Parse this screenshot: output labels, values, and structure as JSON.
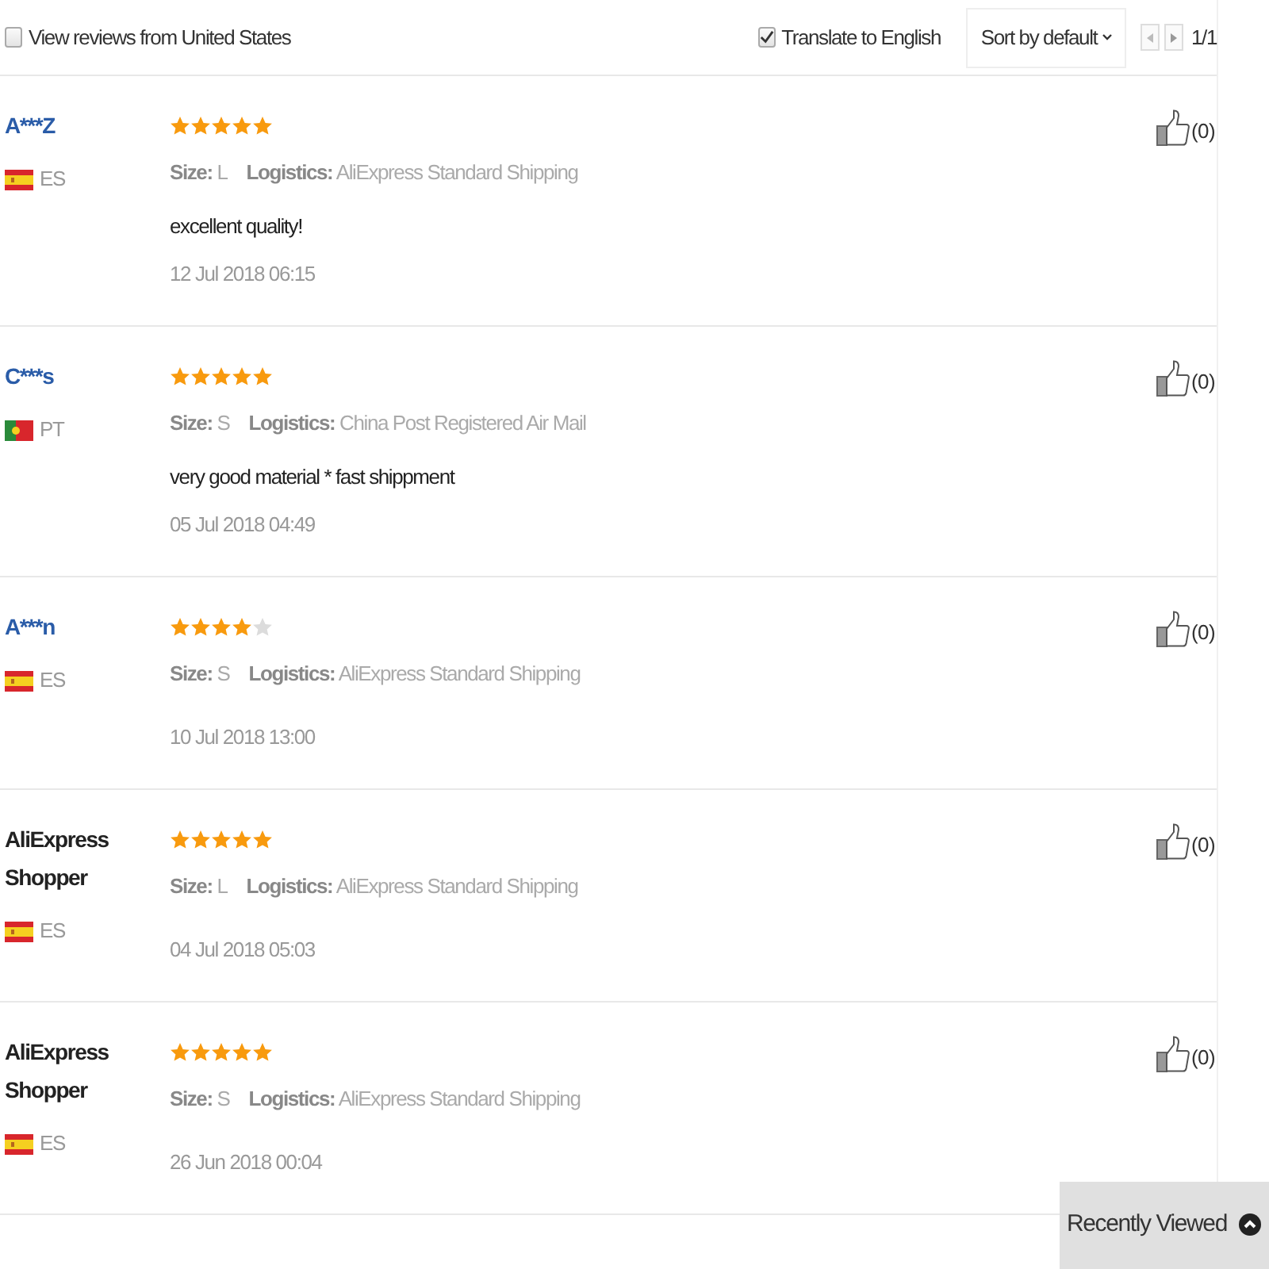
{
  "filters": {
    "country_filter": {
      "label": "View reviews from United States",
      "checked": false
    },
    "translate": {
      "label": "Translate to English",
      "checked": true
    },
    "sort": {
      "label": "Sort by default"
    },
    "pagination": {
      "page": "1/1"
    }
  },
  "reviews": [
    {
      "name": "A***Z",
      "link": true,
      "flag": {
        "kind": "spain"
      },
      "country": "ES",
      "stars": 5,
      "size": "**Size:** L",
      "logistics": "**Logistics:** AliExpress Standard Shipping",
      "comment": "excellent quality!",
      "date": "12 Jul 2018 06:15",
      "likes": "(0)"
    },
    {
      "name": "C***s",
      "link": true,
      "flag": {
        "kind": "portugal"
      },
      "country": "PT",
      "stars": 5,
      "size": "**Size:** S",
      "logistics": "**Logistics:** China Post Registered Air Mail",
      "comment": "very good material * fast shippment",
      "date": "05 Jul 2018 04:49",
      "likes": "(0)"
    },
    {
      "name": "A***n",
      "link": true,
      "flag": {
        "kind": "spain"
      },
      "country": "ES",
      "stars": 4,
      "size": "**Size:** S",
      "logistics": "**Logistics:** AliExpress Standard Shipping",
      "date": "10 Jul 2018 13:00",
      "likes": "(0)"
    },
    {
      "name": "AliExpress Shopper",
      "link": false,
      "flag": {
        "kind": "spain"
      },
      "country": "ES",
      "stars": 5,
      "size": "**Size:** L",
      "logistics": "**Logistics:** AliExpress Standard Shipping",
      "date": "04 Jul 2018 05:03",
      "likes": "(0)"
    },
    {
      "name": "AliExpress Shopper",
      "link": false,
      "flag": {
        "kind": "spain"
      },
      "country": "ES",
      "stars": 5,
      "size": "**Size:** S",
      "logistics": "**Logistics:** AliExpress Standard Shipping",
      "date": "26 Jun 2018 00:04",
      "likes": "(0)"
    }
  ],
  "recently_viewed": {
    "label": "Recently Viewed"
  }
}
